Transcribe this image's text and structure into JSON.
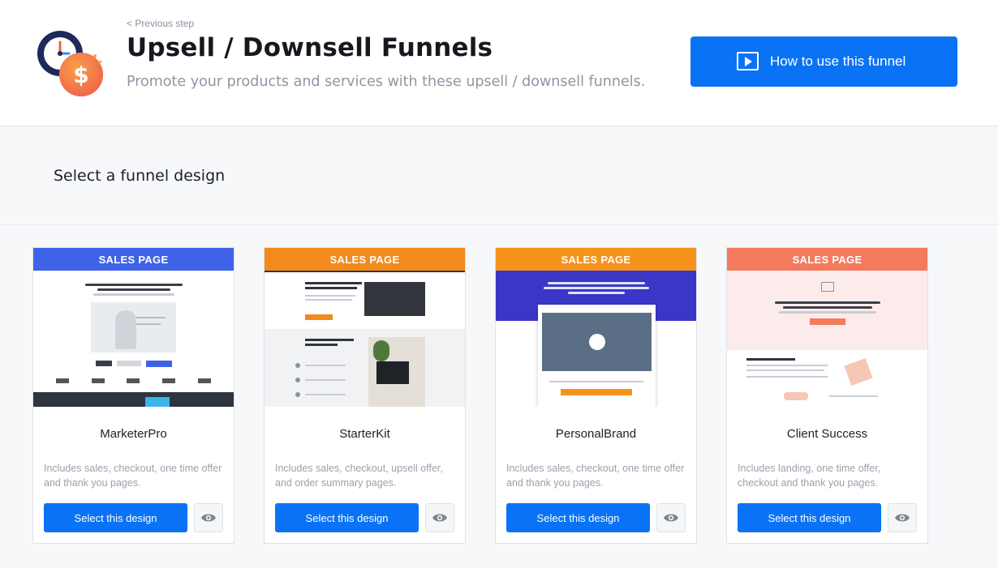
{
  "header": {
    "prev_label": "< Previous step",
    "title": "Upsell / Downsell Funnels",
    "subtitle": "Promote your products and services with these upsell / downsell funnels.",
    "howto_label": "How to use this funnel",
    "logo_icon": "clock-dollar-icon"
  },
  "section": {
    "title": "Select a funnel design"
  },
  "cards": [
    {
      "thumb_label": "SALES PAGE",
      "thumb_color": "#3f63e8",
      "name": "MarketerPro",
      "desc": "Includes sales, checkout, one time offer and thank you pages.",
      "select_label": "Select this design"
    },
    {
      "thumb_label": "SALES PAGE",
      "thumb_color": "#f38a1c",
      "name": "StarterKit",
      "desc": "Includes sales, checkout, upsell offer, and order summary pages.",
      "select_label": "Select this design"
    },
    {
      "thumb_label": "SALES PAGE",
      "thumb_color": "#f6931d",
      "name": "PersonalBrand",
      "desc": "Includes sales, checkout, one time offer and thank you pages.",
      "select_label": "Select this design"
    },
    {
      "thumb_label": "SALES PAGE",
      "thumb_color": "#f47a5e",
      "name": "Client Success",
      "desc": "Includes landing, one time offer, checkout and thank you pages.",
      "select_label": "Select this design"
    }
  ],
  "colors": {
    "primary": "#0a73f5"
  }
}
